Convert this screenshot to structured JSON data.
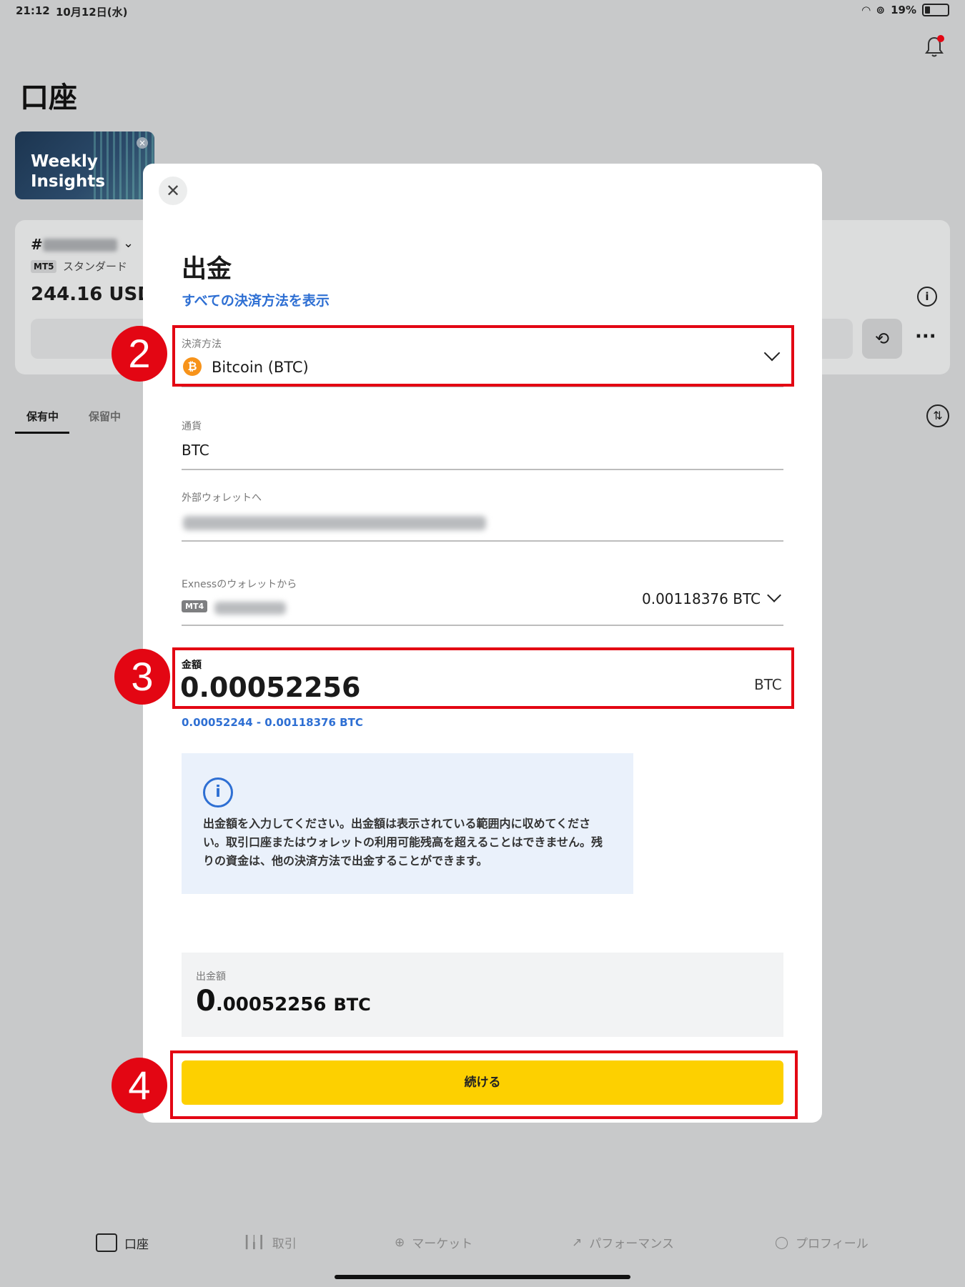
{
  "status_bar": {
    "time": "21:12",
    "date": "10月12日(水)",
    "battery": "19%"
  },
  "page": {
    "title": "口座"
  },
  "weekly_card": {
    "text": "Weekly Insights"
  },
  "account": {
    "number_prefix": "#",
    "platform_badge": "MT5",
    "type": "スタンダード",
    "balance": "244.16 USD"
  },
  "tabs": {
    "holding": "保有中",
    "pending": "保留中"
  },
  "bottom_nav": {
    "account": "口座",
    "trade": "取引",
    "market": "マーケット",
    "performance": "パフォーマンス",
    "profile": "プロフィール"
  },
  "modal": {
    "title": "出金",
    "show_all_link": "すべての決済方法を表示",
    "payment_method": {
      "label": "決済方法",
      "value": "Bitcoin (BTC)"
    },
    "currency": {
      "label": "通貨",
      "value": "BTC"
    },
    "external_wallet": {
      "label": "外部ウォレットへ"
    },
    "from_wallet": {
      "label": "Exnessのウォレットから",
      "badge": "MT4",
      "balance": "0.00118376 BTC"
    },
    "amount": {
      "label": "金額",
      "value": "0.00052256",
      "unit": "BTC",
      "range": "0.00052244 - 0.00118376 BTC"
    },
    "info_text": "出金額を入力してください。出金額は表示されている範囲内に収めてください。取引口座またはウォレットの利用可能残高を超えることはできません。残りの資金は、他の決済方法で出金することができます。",
    "summary": {
      "label": "出金額",
      "value_integer": "0",
      "value_decimal": ".00052256",
      "unit": "BTC"
    },
    "continue_button": "続ける"
  },
  "annotations": {
    "step_2": "2",
    "step_3": "3",
    "step_4": "4",
    "color": "#e30613"
  },
  "colors": {
    "accent_yellow": "#fdd000",
    "link_blue": "#2e6fd3",
    "bitcoin_orange": "#f7931a"
  }
}
